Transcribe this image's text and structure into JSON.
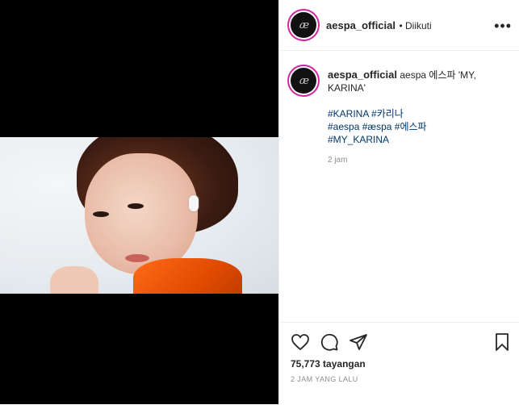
{
  "post": {
    "views_count": "75,773",
    "views_suffix": "tayangan",
    "time_ago": "2 JAM YANG LALU"
  },
  "header": {
    "username": "aespa_official",
    "follow_status": "• Diikuti",
    "avatar_monogram": "æ"
  },
  "caption": {
    "username": "aespa_official",
    "text": "aespa 에스파 'MY, KARINA'",
    "hashtags_line1": [
      "#KARINA",
      "#카리나"
    ],
    "hashtags_line2": [
      "#aespa",
      "#æspa",
      "#에스파"
    ],
    "hashtags_line3": [
      "#MY_KARINA"
    ],
    "timestamp": "2 jam"
  },
  "icons": {
    "more": "more-options-icon",
    "like": "heart-icon",
    "comment": "comment-icon",
    "share": "share-icon",
    "save": "bookmark-icon"
  },
  "colors": {
    "link": "#00376b",
    "story_ring": "#d6249f",
    "text": "#262626",
    "muted": "#8e8e8e"
  }
}
